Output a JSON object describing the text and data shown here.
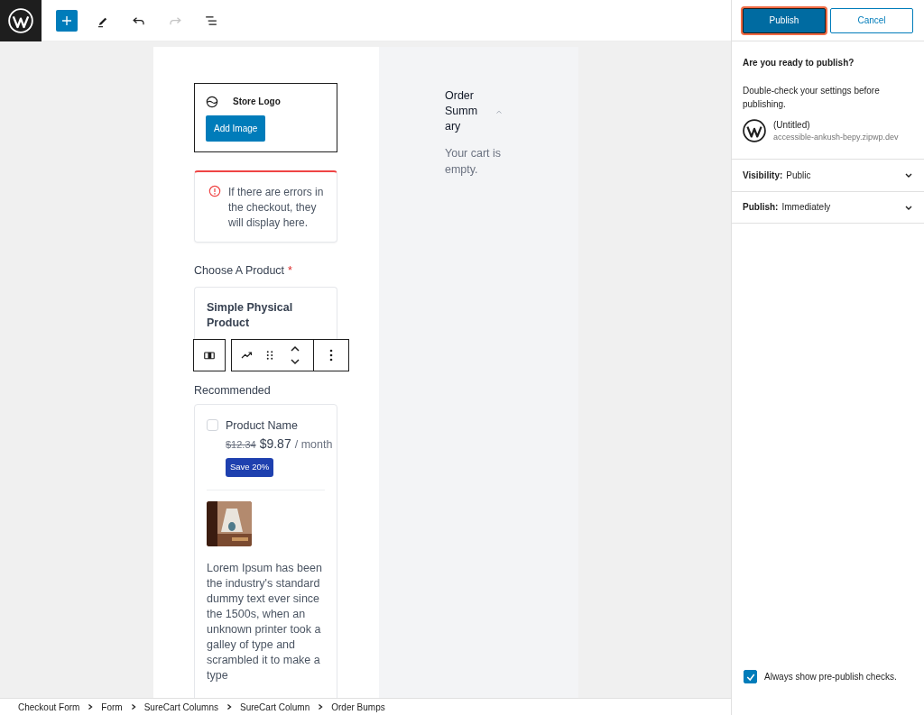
{
  "toolbar": {
    "buttons": [
      {
        "kind": "add",
        "disabled": false
      },
      {
        "kind": "edit",
        "disabled": false
      },
      {
        "kind": "undo",
        "disabled": false
      },
      {
        "kind": "redo",
        "disabled": true
      },
      {
        "kind": "list",
        "disabled": false
      }
    ]
  },
  "canvas": {
    "store_logo": {
      "label": "Store Logo",
      "button": "Add Image"
    },
    "error_notice": {
      "text": "If there are errors in the checkout, they will display here."
    },
    "product_field": {
      "label": "Choose A Product",
      "required_mark": "*",
      "product_name": "Simple Physical Product"
    },
    "recommended": {
      "label": "Recommended",
      "items": [
        {
          "name": "Product Name",
          "checked": false,
          "old_price": "$12.34",
          "price": "$9.87",
          "period": "/ month",
          "badge": "Save 20%",
          "description": "Lorem Ipsum has been the industry's standard dummy text ever since the 1500s, when an unknown printer took a galley of type and scrambled it to make a type"
        }
      ]
    },
    "order_summary": {
      "title": "Order Summary",
      "expanded": true,
      "empty_text": "Your cart is empty."
    }
  },
  "sidebar": {
    "buttons": [
      {
        "label": "Publish",
        "kind": "primary",
        "focused": true
      },
      {
        "label": "Cancel",
        "kind": "secondary",
        "focused": false
      }
    ],
    "heading": "Are you ready to publish?",
    "description": "Double-check your settings before publishing.",
    "site": {
      "title": "(Untitled)",
      "url": "accessible-ankush-bepy.zipwp.dev"
    },
    "panels": [
      {
        "label": "Visibility:",
        "value": "Public",
        "expanded": false
      },
      {
        "label": "Publish:",
        "value": "Immediately",
        "expanded": false
      }
    ],
    "always_show": {
      "label": "Always show pre-publish checks.",
      "checked": true
    }
  },
  "breadcrumb": [
    "Checkout Form",
    "Form",
    "SureCart Columns",
    "SureCart Column",
    "Order Bumps"
  ]
}
